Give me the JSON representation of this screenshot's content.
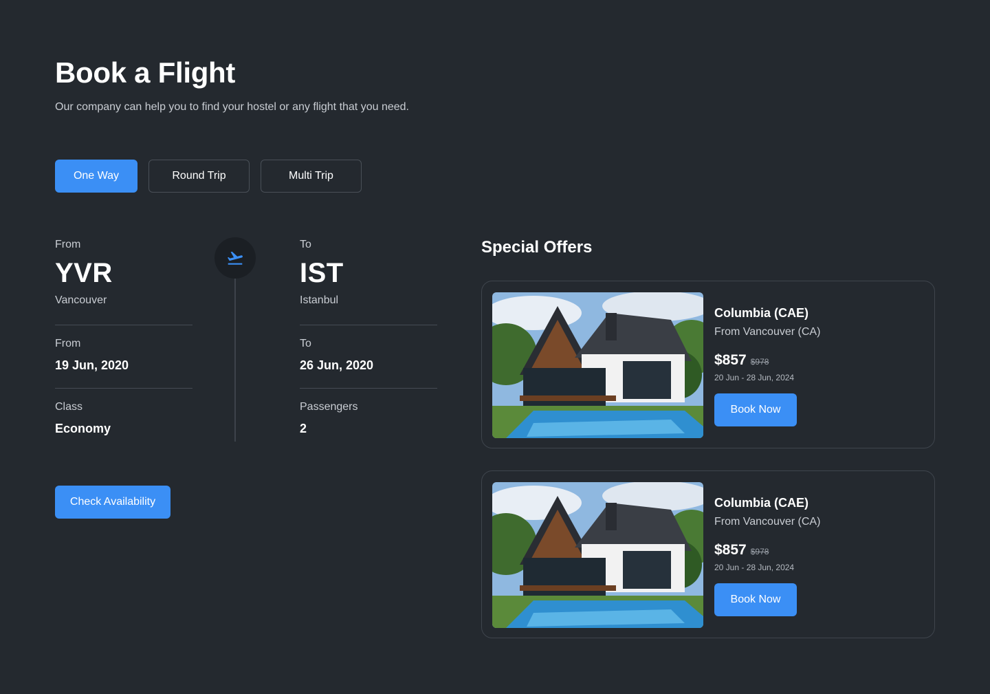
{
  "header": {
    "title": "Book a Flight",
    "subtitle": "Our company can help you to find your hostel or any flight that you need."
  },
  "trip_types": {
    "one_way": "One Way",
    "round_trip": "Round Trip",
    "multi_trip": "Multi Trip",
    "selected": "One Way"
  },
  "flight": {
    "from_label": "From",
    "from_code": "YVR",
    "from_city": "Vancouver",
    "to_label": "To",
    "to_code": "IST",
    "to_city": "Istanbul",
    "depart_label": "From",
    "depart_date": "19 Jun, 2020",
    "return_label": "To",
    "return_date": "26 Jun, 2020",
    "class_label": "Class",
    "class_value": "Economy",
    "passengers_label": "Passengers",
    "passengers_value": "2",
    "route_icon": "plane-takeoff-icon"
  },
  "check_button": "Check Availability",
  "offers": {
    "title": "Special Offers",
    "items": [
      {
        "name": "Columbia (CAE)",
        "origin": "From Vancouver (CA)",
        "price": "$857",
        "old_price": "$978",
        "dates": "20 Jun - 28 Jun, 2024",
        "button": "Book Now"
      },
      {
        "name": "Columbia (CAE)",
        "origin": "From Vancouver (CA)",
        "price": "$857",
        "old_price": "$978",
        "dates": "20 Jun - 28 Jun, 2024",
        "button": "Book Now"
      }
    ]
  },
  "colors": {
    "background": "#24292f",
    "accent": "#3b8ff5",
    "border": "#3f454d"
  }
}
